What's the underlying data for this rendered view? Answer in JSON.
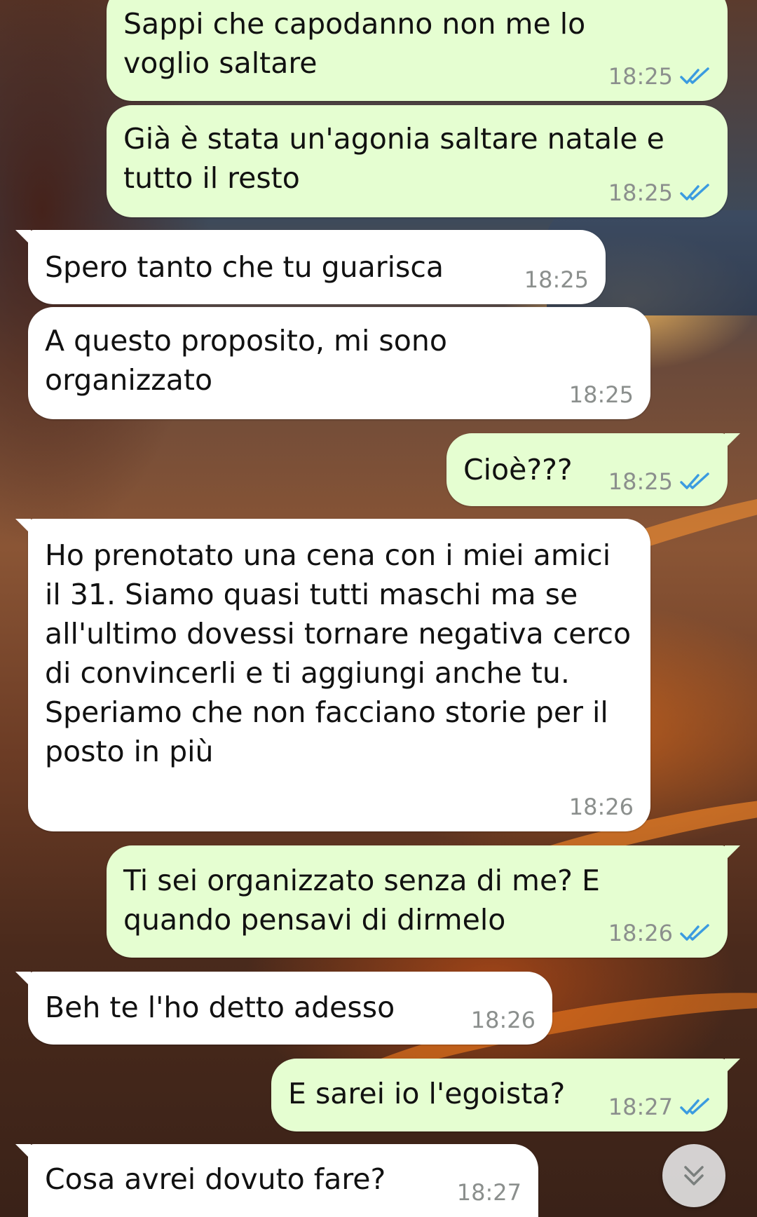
{
  "messages": [
    {
      "direction": "out",
      "text": "Sappi che capodanno non me lo voglio saltare",
      "time": "18:25",
      "status": "read"
    },
    {
      "direction": "out",
      "text": "Già è stata un'agonia saltare natale e tutto il resto",
      "time": "18:25",
      "status": "read"
    },
    {
      "direction": "in",
      "text": "Spero tanto che tu guarisca",
      "time": "18:25"
    },
    {
      "direction": "in",
      "text": "A questo proposito, mi sono organizzato",
      "time": "18:25"
    },
    {
      "direction": "out",
      "text": "Cioè???",
      "time": "18:25",
      "status": "read"
    },
    {
      "direction": "in",
      "text": "Ho prenotato una cena con i miei amici il 31. Siamo quasi tutti maschi ma se all'ultimo dovessi tornare negativa cerco di convincerli e ti aggiungi anche tu. Speriamo che non facciano storie per il posto in più",
      "time": "18:26"
    },
    {
      "direction": "out",
      "text": "Ti sei organizzato senza di me? E quando pensavi di dirmelo",
      "time": "18:26",
      "status": "read"
    },
    {
      "direction": "in",
      "text": "Beh te l'ho detto adesso",
      "time": "18:26"
    },
    {
      "direction": "out",
      "text": "E sarei io l'egoista?",
      "time": "18:27",
      "status": "read"
    },
    {
      "direction": "in",
      "text": "Cosa avrei dovuto fare?",
      "time": "18:27"
    }
  ],
  "scroll_button": {
    "icon": "double-chevron-down-icon"
  },
  "colors": {
    "outgoing_bubble": "#e5fed1",
    "incoming_bubble": "#ffffff",
    "read_ticks": "#3b9be0",
    "timestamp": "#8b8f8d"
  }
}
